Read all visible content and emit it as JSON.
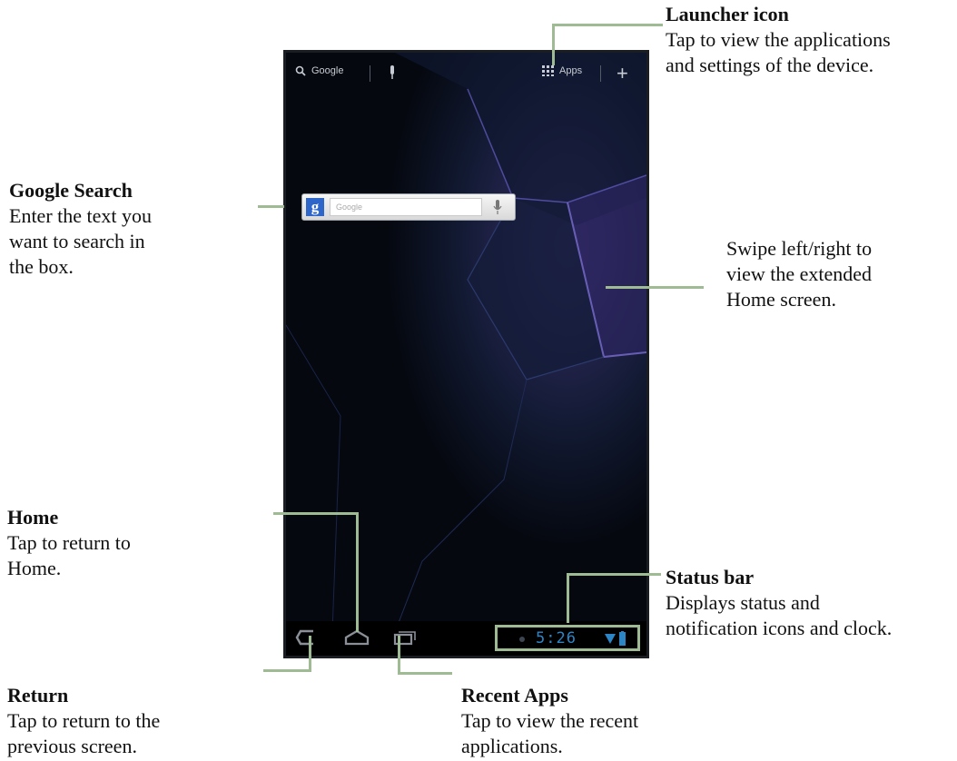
{
  "callouts": {
    "launcher": {
      "title": "Launcher icon",
      "desc": [
        "Tap to view the applications",
        "and settings of the device."
      ]
    },
    "google_search": {
      "title": "Google Search",
      "desc": [
        "Enter the text you",
        "want to search in",
        "the box."
      ]
    },
    "swipe": {
      "desc": [
        "Swipe left/right to",
        "view the extended",
        "Home screen."
      ]
    },
    "home": {
      "title": "Home",
      "desc": [
        "Tap to return to",
        "Home."
      ]
    },
    "status_bar": {
      "title": "Status bar",
      "desc": [
        "Displays status and",
        "notification icons and clock."
      ]
    },
    "return": {
      "title": "Return",
      "desc": [
        "Tap to return to the",
        "previous screen."
      ]
    },
    "recent_apps": {
      "title": "Recent Apps",
      "desc": [
        "Tap to view the recent",
        "applications."
      ]
    }
  },
  "device": {
    "topbar": {
      "search_label": "Google",
      "apps_label": "Apps",
      "plus_symbol": "+"
    },
    "search_widget": {
      "logo": "g",
      "placeholder": "Google"
    },
    "system_bar": {
      "clock": "5:26",
      "icons": [
        "back-icon",
        "home-icon",
        "recent-apps-icon",
        "wifi-icon",
        "battery-icon"
      ]
    }
  },
  "colors": {
    "leader_lines": "#9fbb93",
    "clock": "#2c86c6",
    "screen_bg": "#05080f"
  }
}
